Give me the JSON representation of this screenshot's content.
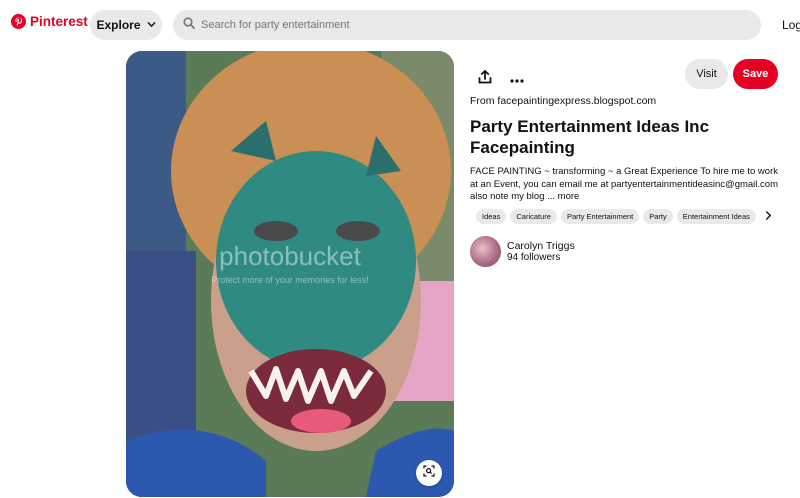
{
  "header": {
    "logo_text": "Pinterest",
    "explore_label": "Explore",
    "search_placeholder": "Search for party entertainment",
    "login_label": "Log"
  },
  "image": {
    "watermark_top": "photobucket",
    "watermark_bottom": "Protect more of your memories for less!"
  },
  "pin": {
    "visit_label": "Visit",
    "save_label": "Save",
    "from_prefix": "From",
    "source_domain": "facepaintingexpress.blogspot.com",
    "title": "Party Entertainment Ideas Inc Facepainting",
    "description": "FACE PAINTING ~ transforming ~ a Great Experience To hire me to work at an Event, you can email me at partyentertainmentideasinc@gmail.com also note my blog",
    "more_label": "... more",
    "tags": [
      "Ideas",
      "Caricature",
      "Party Entertainment",
      "Party",
      "Entertainment Ideas"
    ]
  },
  "creator": {
    "name": "Carolyn Triggs",
    "followers": "94 followers"
  },
  "colors": {
    "brand_red": "#e60023",
    "pill_gray": "#e9e9e9"
  },
  "icons": [
    "pinterest-logo-icon",
    "chevron-down-icon",
    "search-icon",
    "share-icon",
    "more-icon",
    "visual-search-icon",
    "chevron-right-icon"
  ]
}
